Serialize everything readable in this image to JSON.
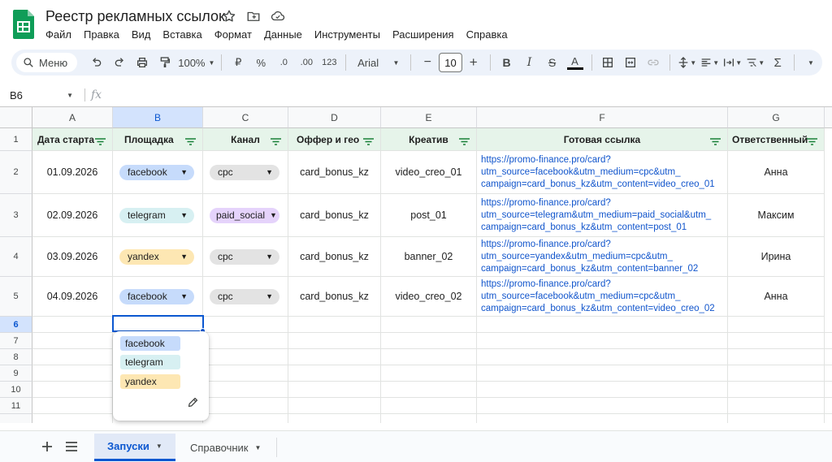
{
  "app": {
    "title": "Реестр рекламных ссылок",
    "menu": [
      "Файл",
      "Правка",
      "Вид",
      "Вставка",
      "Формат",
      "Данные",
      "Инструменты",
      "Расширения",
      "Справка"
    ]
  },
  "toolbar": {
    "menu_label": "Меню",
    "zoom": "100%",
    "currency": "₽",
    "percent": "%",
    "dec_decrease": ".0",
    "dec_increase": ".00",
    "number_format": "123",
    "font": "Arial",
    "font_size": "10",
    "minus": "−",
    "plus": "+",
    "bold": "B",
    "italic": "I",
    "strike": "S",
    "text_color": "A",
    "sum": "Σ"
  },
  "formula_bar": {
    "cell_ref": "B6",
    "fx": "fx"
  },
  "columns": [
    "A",
    "B",
    "C",
    "D",
    "E",
    "F",
    "G"
  ],
  "rows": [
    "1",
    "2",
    "3",
    "4",
    "5",
    "6",
    "7",
    "8",
    "9",
    "10",
    "11"
  ],
  "headers": [
    "Дата старта",
    "Площадка",
    "Канал",
    "Оффер и гео",
    "Креатив",
    "Готовая ссылка",
    "Ответственный"
  ],
  "data_rows": [
    {
      "date": "01.09.2026",
      "platform": "facebook",
      "channel": "cpc",
      "offer": "card_bonus_kz",
      "creative": "video_creo_01",
      "link": [
        "https://promo-finance.pro/card?",
        "utm_source=facebook&utm_medium=cpc&utm_",
        "campaign=card_bonus_kz&utm_content=video_creo_01"
      ],
      "owner": "Анна"
    },
    {
      "date": "02.09.2026",
      "platform": "telegram",
      "channel": "paid_social",
      "offer": "card_bonus_kz",
      "creative": "post_01",
      "link": [
        "https://promo-finance.pro/card?",
        "utm_source=telegram&utm_medium=paid_social&utm_",
        "campaign=card_bonus_kz&utm_content=post_01"
      ],
      "owner": "Максим"
    },
    {
      "date": "03.09.2026",
      "platform": "yandex",
      "channel": "cpc",
      "offer": "card_bonus_kz",
      "creative": "banner_02",
      "link": [
        "https://promo-finance.pro/card?",
        "utm_source=yandex&utm_medium=cpc&utm_",
        "campaign=card_bonus_kz&utm_content=banner_02"
      ],
      "owner": "Ирина"
    },
    {
      "date": "04.09.2026",
      "platform": "facebook",
      "channel": "cpc",
      "offer": "card_bonus_kz",
      "creative": "video_creo_02",
      "link": [
        "https://promo-finance.pro/card?",
        "utm_source=facebook&utm_medium=cpc&utm_",
        "campaign=card_bonus_kz&utm_content=video_creo_02"
      ],
      "owner": "Анна"
    }
  ],
  "dropdown": {
    "options": [
      "facebook",
      "telegram",
      "yandex"
    ]
  },
  "sheets": [
    {
      "name": "Запуски",
      "active": true
    },
    {
      "name": "Справочник",
      "active": false
    }
  ],
  "colors": {
    "facebook": "#c6dbfb",
    "telegram": "#d7f0f2",
    "yandex": "#fde7b3",
    "cpc": "#e3e3e3",
    "paid_social": "#e5d3fb",
    "header_fill": "#e6f4ea",
    "accent": "#0b57d0",
    "link": "#1155cc"
  }
}
